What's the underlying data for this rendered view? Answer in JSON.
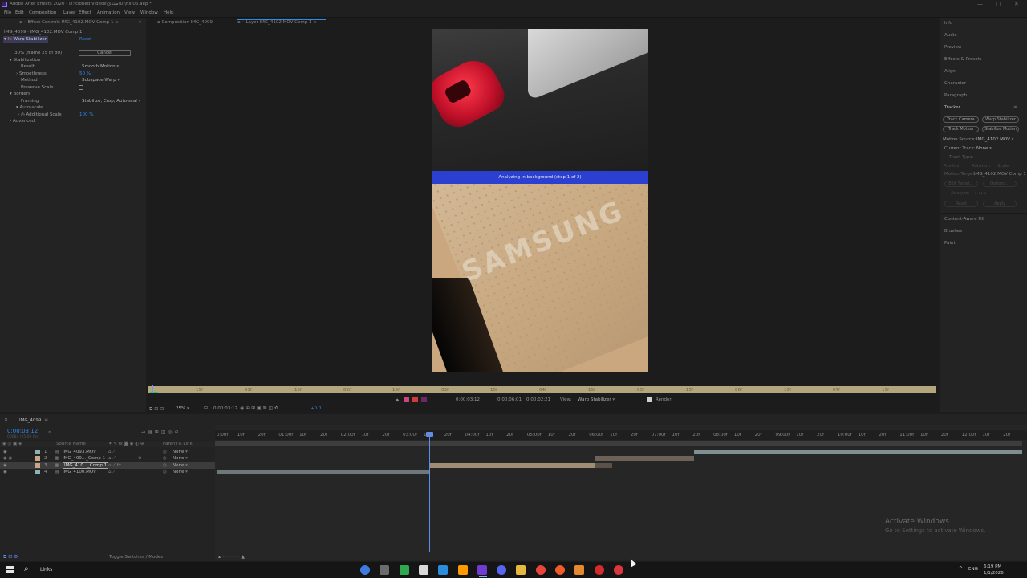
{
  "window": {
    "title": "Adobe After Effects 2020 - D:\\cloned Videos\\مبتدئ\\UI\\fix 06.aep *",
    "min": "—",
    "max": "▢",
    "close": "✕"
  },
  "menu": [
    "File",
    "Edit",
    "Composition",
    "Layer",
    "Effect",
    "Animation",
    "View",
    "Window",
    "Help"
  ],
  "effect_controls": {
    "tab_label": "Effect Controls IMG_4102.MOV Comp 1",
    "breadcrumb": "IMG_4099 · IMG_4102.MOV Comp 1",
    "effect_name": "Warp Stabilizer",
    "reset": "Reset",
    "progress_text": "30% (frame 25 of 80)",
    "cancel": "Cancel",
    "stabilization": "Stabilization",
    "result_label": "Result",
    "result_value": "Smooth Motion",
    "smoothness_label": "Smoothness",
    "smoothness_value": "50 %",
    "method_label": "Method",
    "method_value": "Subspace Warp",
    "preserve_scale": "Preserve Scale",
    "borders": "Borders",
    "framing_label": "Framing",
    "framing_value": "Stabilize, Crop, Auto-scal",
    "auto_scale": "Auto-scale",
    "additional_scale_label": "Additional Scale",
    "additional_scale_value": "100 %",
    "advanced": "Advanced"
  },
  "viewer": {
    "tab_composition": "Composition IMG_4099",
    "tab_layer": "Layer IMG_4102.MOV Comp 1",
    "analyze_text": "Analyzing in background (step 1 of 2)",
    "brand_text": "SAMSUNG",
    "ruler_ticks": [
      "00f",
      "15f",
      "01f",
      "15f",
      "02f",
      "15f",
      "03f",
      "15f",
      "04f",
      "15f",
      "05f",
      "15f",
      "06f",
      "15f",
      "07f",
      "15f",
      "08f"
    ],
    "zoom": "25%",
    "timecode": "0:00:03:12",
    "in_time": "0:00:03:12",
    "out_time": "0:00:06:01",
    "duration": "0:00:02:21",
    "view_label": "View:",
    "view_value": "Warp Stabilizer",
    "render_label": "Render",
    "exposure": "+0.0"
  },
  "right_panel": {
    "items": [
      "Info",
      "Audio",
      "Preview",
      "Effects & Presets",
      "Align",
      "Character",
      "Paragraph",
      "Tracker"
    ],
    "track_camera": "Track Camera",
    "warp_stabilizer": "Warp Stabilizer",
    "track_motion": "Track Motion",
    "stabilize_motion": "Stabilize Motion",
    "motion_source_label": "Motion Source:",
    "motion_source_value": "IMG_4102.MOV",
    "current_track_label": "Current Track:",
    "current_track_value": "None",
    "track_type_label": "Track Type:",
    "position": "Position",
    "rotation": "Rotation",
    "scale": "Scale",
    "motion_target_label": "Motion Target:",
    "motion_target_value": "IMG_4102.MOV Comp 1",
    "edit_target": "Edit Target...",
    "options": "Options...",
    "analyze": "Analyze:",
    "reset": "Reset",
    "apply": "Apply",
    "bottom_items": [
      "Content-Aware Fill",
      "Brushes",
      "Paint"
    ]
  },
  "timeline": {
    "comp_tab": "IMG_4099",
    "current_time": "0:00:03:12",
    "fps_text": "00084 (25.00 fps)",
    "col_source": "Source Name",
    "col_parent": "Parent & Link",
    "layers": [
      {
        "num": "1",
        "name": "IMG_4093.MOV",
        "parent": "None"
      },
      {
        "num": "2",
        "name": "IMG_409..._Comp 1",
        "parent": "None"
      },
      {
        "num": "3",
        "name": "IMG_410..._Comp 1",
        "parent": "None"
      },
      {
        "num": "4",
        "name": "IMG_4100.MOV",
        "parent": "None"
      }
    ],
    "ruler": [
      "0:00f",
      "10f",
      "20f",
      "01:00f",
      "10f",
      "20f",
      "02:00f",
      "10f",
      "20f",
      "03:00f",
      "10f",
      "20f",
      "04:00f",
      "10f",
      "20f",
      "05:00f",
      "10f",
      "20f",
      "06:00f",
      "10f",
      "20f",
      "07:00f",
      "10f",
      "20f",
      "08:00f",
      "10f",
      "20f",
      "09:00f",
      "10f",
      "20f",
      "10:00f",
      "10f",
      "20f",
      "11:00f",
      "10f",
      "20f",
      "12:00f",
      "10f",
      "20f"
    ],
    "toggle_label": "Toggle Switches / Modes"
  },
  "activate": {
    "title": "Activate Windows",
    "subtitle": "Go to Settings to activate Windows."
  },
  "taskbar": {
    "search": "Links",
    "lang": "ENG",
    "time": "6:19 PM",
    "date": "1/1/2026",
    "icons": [
      "chrome-canary-icon",
      "grid-app-icon",
      "xbox-icon",
      "pen-app-icon",
      "vscode-icon",
      "illustrator-icon",
      "after-effects-icon",
      "discord-icon",
      "file-explorer-icon",
      "chrome-icon",
      "brave-icon",
      "text-editor-icon",
      "opera-icon",
      "chrome-red-icon"
    ],
    "colors": [
      "#3f7ae0",
      "#6b6b6b",
      "#2fa84f",
      "#d9d9d9",
      "#2c8ddc",
      "#ff9a00",
      "#6e3bd3",
      "#5865f2",
      "#e6b93d",
      "#e8453c",
      "#f15a29",
      "#e38a2e",
      "#d42c2c",
      "#d9363e"
    ]
  }
}
